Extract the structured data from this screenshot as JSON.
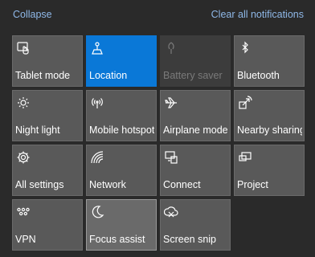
{
  "header": {
    "collapse_label": "Collapse",
    "clear_label": "Clear all notifications"
  },
  "colors": {
    "background": "#2a2a2a",
    "tile": "#595959",
    "tile_active": "#0a78d7",
    "tile_disabled": "#3c3c3c",
    "link": "#8fb8e8"
  },
  "tiles": [
    {
      "label": "Tablet mode",
      "icon": "tablet-mode-icon",
      "state": "off"
    },
    {
      "label": "Location",
      "icon": "location-icon",
      "state": "on"
    },
    {
      "label": "Battery saver",
      "icon": "battery-saver-icon",
      "state": "disabled"
    },
    {
      "label": "Bluetooth",
      "icon": "bluetooth-icon",
      "state": "off"
    },
    {
      "label": "Night light",
      "icon": "night-light-icon",
      "state": "off"
    },
    {
      "label": "Mobile hotspot",
      "icon": "mobile-hotspot-icon",
      "state": "off"
    },
    {
      "label": "Airplane mode",
      "icon": "airplane-icon",
      "state": "off"
    },
    {
      "label": "Nearby sharing",
      "icon": "nearby-sharing-icon",
      "state": "off"
    },
    {
      "label": "All settings",
      "icon": "gear-icon",
      "state": "off"
    },
    {
      "label": "Network",
      "icon": "network-icon",
      "state": "off"
    },
    {
      "label": "Connect",
      "icon": "connect-icon",
      "state": "off"
    },
    {
      "label": "Project",
      "icon": "project-icon",
      "state": "off"
    },
    {
      "label": "VPN",
      "icon": "vpn-icon",
      "state": "off"
    },
    {
      "label": "Focus assist",
      "icon": "moon-icon",
      "state": "focused"
    },
    {
      "label": "Screen snip",
      "icon": "screen-snip-icon",
      "state": "off"
    }
  ]
}
